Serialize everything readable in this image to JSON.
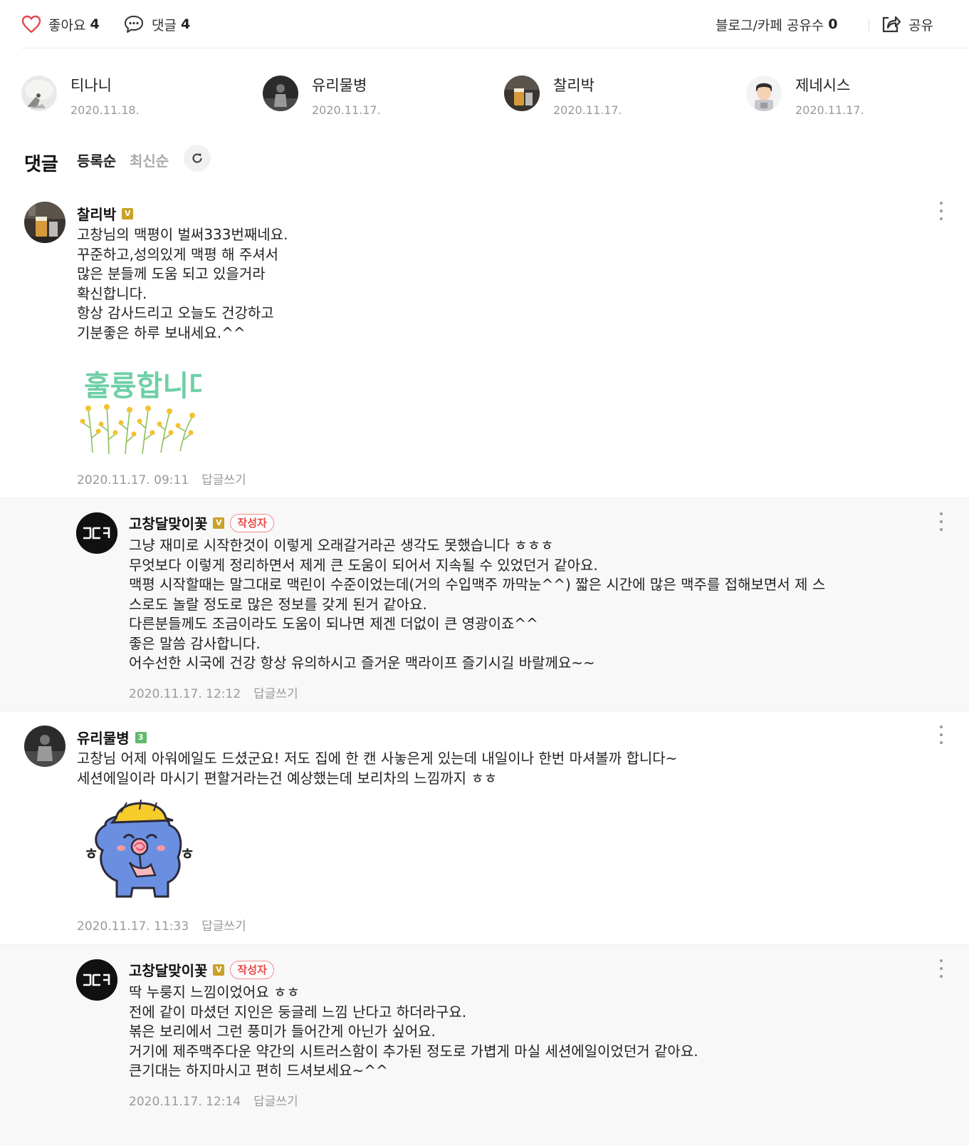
{
  "actions": {
    "like_label": "좋아요",
    "like_count": "4",
    "comment_label": "댓글",
    "comment_count": "4",
    "share_count_label": "블로그/카페 공유수",
    "share_count": "0",
    "share_label": "공유"
  },
  "likers": [
    {
      "name": "티나니",
      "date": "2020.11.18."
    },
    {
      "name": "유리물병",
      "date": "2020.11.17."
    },
    {
      "name": "찰리박",
      "date": "2020.11.17."
    },
    {
      "name": "제네시스",
      "date": "2020.11.17."
    }
  ],
  "comments_header": {
    "title": "댓글",
    "sort_registered": "등록순",
    "sort_latest": "최신순"
  },
  "comments": [
    {
      "author": "찰리박",
      "badge": "V",
      "text": "고창님의 맥평이 벌써333번째네요.\n꾸준하고,성의있게 맥평 해 주셔서\n많은 분들께 도움 되고 있을거라\n확신합니다.\n항상 감사드리고 오늘도 건강하고\n기분좋은 하루 보내세요.^^",
      "sticker_text": "훌륭합니다",
      "time": "2020.11.17. 09:11",
      "reply_label": "답글쓰기"
    },
    {
      "author": "고창달맞이꽃",
      "badge": "V",
      "writer_badge": "작성자",
      "avatar_text": "고당",
      "text": "그냥 재미로 시작한것이 이렇게 오래갈거라곤 생각도 못했습니다 ㅎㅎㅎ\n무엇보다 이렇게 정리하면서 제게 큰 도움이 되어서 지속될 수 있었던거 같아요.\n맥평 시작할때는 말그대로 맥린이 수준이었는데(거의 수입맥주 까막눈^^) 짧은 시간에 많은 맥주를 접해보면서 제 스\n스로도 놀랄 정도로 많은 정보를 갖게 된거 같아요.\n다른분들께도 조금이라도 도움이 되나면 제겐 더없이 큰 영광이죠^^\n좋은 말씀 감사합니다.\n어수선한 시국에 건강 항상 유의하시고 즐거운 맥라이프 즐기시길 바랄께요~~",
      "time": "2020.11.17. 12:12",
      "reply_label": "답글쓰기"
    },
    {
      "author": "유리물병",
      "badge": "3",
      "text": "고창님 어제 아워에일도 드셨군요! 저도 집에 한 캔 사놓은게 있는데 내일이나 한번 마셔볼까 합니다~\n세션에일이라 마시기 편할거라는건 예상했는데 보리차의 느낌까지 ㅎㅎ",
      "sticker_text": "ㅎ",
      "time": "2020.11.17. 11:33",
      "reply_label": "답글쓰기"
    },
    {
      "author": "고창달맞이꽃",
      "badge": "V",
      "writer_badge": "작성자",
      "avatar_text": "고당",
      "text": "딱 누룽지 느낌이었어요 ㅎㅎ\n전에 같이 마셨던 지인은 둥글레 느낌 난다고 하더라구요.\n볶은 보리에서 그런 풍미가 들어간게 아닌가 싶어요.\n거기에 제주맥주다운 약간의 시트러스함이 추가된 정도로 가볍게 마실 세션에일이었던거 같아요.\n큰기대는 하지마시고 편히 드셔보세요~^^",
      "time": "2020.11.17. 12:14",
      "reply_label": "답글쓰기"
    }
  ]
}
